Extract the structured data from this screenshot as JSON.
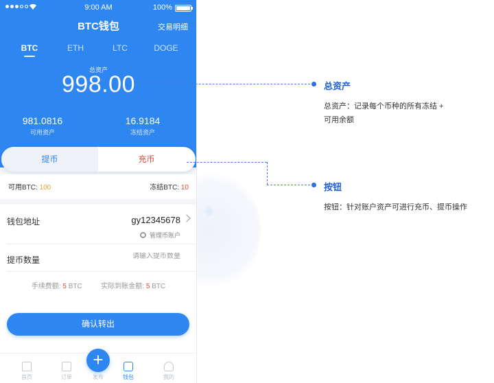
{
  "status_bar": {
    "time": "9:00 AM",
    "battery": "100%"
  },
  "header": {
    "title": "BTC钱包",
    "link": "交易明细"
  },
  "tabs": [
    "BTC",
    "ETH",
    "LTC",
    "DOGE"
  ],
  "total": {
    "label": "总资产",
    "value": "998.00"
  },
  "available": {
    "value": "981.0816",
    "label": "可用资产"
  },
  "frozen": {
    "value": "16.9184",
    "label": "冻结资产"
  },
  "actions": {
    "withdraw": "提币",
    "deposit": "充币"
  },
  "balances": {
    "avail_label": "可用BTC:",
    "avail_value": "100",
    "frozen_label": "冻结BTC:",
    "frozen_value": "10"
  },
  "form": {
    "address_label": "钱包地址",
    "address_value": "gy12345678",
    "manage_label": "管理币账户",
    "amount_label": "提币数量",
    "amount_placeholder": "请输入提币数量",
    "fee_label": "手续费额:",
    "fee_value": "5",
    "fee_unit": "BTC",
    "actual_label": "实际到账金额:",
    "actual_value": "5",
    "actual_unit": "BTC",
    "confirm": "确认转出"
  },
  "tabbar": {
    "home": "首页",
    "orders": "订单",
    "publish": "发布",
    "wallet": "钱包",
    "me": "我的"
  },
  "annotations": [
    {
      "title": "总资产",
      "desc_line1": "总资产：记录每个币种的所有冻结 +",
      "desc_line2": "可用余额"
    },
    {
      "title": "按钮",
      "desc": "按钮：针对账户资产可进行充币、提币操作"
    }
  ],
  "colors": {
    "primary": "#2e86f0",
    "deposit": "#e14a33",
    "highlight": "#f0a030",
    "annotation": "#1f5fd6"
  }
}
